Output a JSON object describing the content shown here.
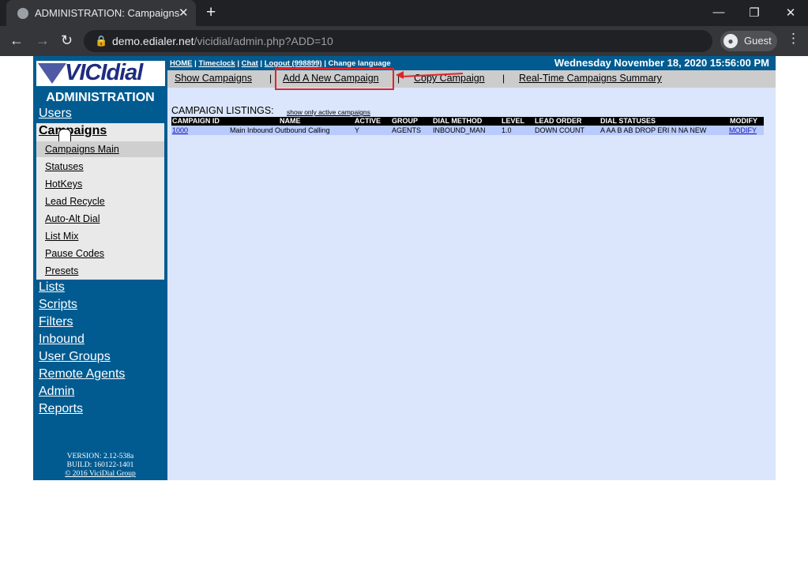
{
  "browser": {
    "tab_title": "ADMINISTRATION: Campaigns",
    "tab_close_icon": "close-icon",
    "new_tab_label": "+",
    "url_host": "demo.edialer.net",
    "url_path": "/vicidial/admin.php?ADD=10",
    "profile_label": "Guest",
    "window_controls": [
      "minimize-icon",
      "restore-icon",
      "close-icon"
    ]
  },
  "header": {
    "logo_text": "VICIdial",
    "home": "HOME",
    "timeclock": "Timeclock",
    "chat": "Chat",
    "logout": "Logout (998899)",
    "change_language": "Change language",
    "datetime": "Wednesday November 18, 2020 15:56:00 PM"
  },
  "sidebar": {
    "title": "ADMINISTRATION",
    "users": "Users",
    "campaigns": "Campaigns",
    "sub_items": [
      "Campaigns Main",
      "Statuses",
      "HotKeys",
      "Lead Recycle",
      "Auto-Alt Dial",
      "List Mix",
      "Pause Codes",
      "Presets"
    ],
    "other_items": [
      "Lists",
      "Scripts",
      "Filters",
      "Inbound",
      "User Groups",
      "Remote Agents",
      "Admin",
      "Reports"
    ],
    "version": "VERSION: 2.12-538a",
    "build": "BUILD: 160122-1401",
    "copyright": "© 2016 ViciDial Group"
  },
  "subnav": {
    "show_campaigns": "Show Campaigns",
    "add_campaign": "Add A New Campaign",
    "copy_campaign": "Copy Campaign",
    "realtime_summary": "Real-Time Campaigns Summary",
    "separator": "|"
  },
  "listing": {
    "label": "CAMPAIGN LISTINGS:",
    "filter_link": "show only active campaigns",
    "columns": [
      "CAMPAIGN ID",
      "NAME",
      "ACTIVE",
      "GROUP",
      "DIAL METHOD",
      "LEVEL",
      "LEAD ORDER",
      "DIAL STATUSES",
      "MODIFY"
    ],
    "rows": [
      {
        "campaign_id": "1000",
        "name": "Main Inbound Outbound Calling",
        "active": "Y",
        "group": "AGENTS",
        "dial_method": "INBOUND_MAN",
        "level": "1.0",
        "lead_order": "DOWN COUNT",
        "dial_statuses": "A AA B AB DROP ERI N NA NEW",
        "modify": "MODIFY"
      }
    ]
  },
  "colors": {
    "accent": "#015b91",
    "page_bg": "#dbe6fc",
    "highlight": "#e0242b"
  }
}
